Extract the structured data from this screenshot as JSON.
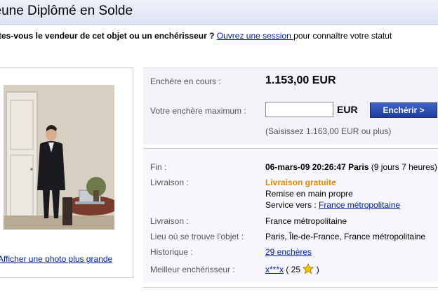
{
  "page": {
    "title": "Jeune Diplômé en Solde"
  },
  "status": {
    "question": "Êtes-vous le vendeur de cet objet ou un enchérisseur ?",
    "login_link": "Ouvrez une session ",
    "suffix": "pour connaître votre statut"
  },
  "photo": {
    "enlarge_link": "Afficher une photo plus grande"
  },
  "bid": {
    "current_label": "Enchère en cours :",
    "current_value": "1.153,00 EUR",
    "max_label": "Votre enchère maximum :",
    "max_value": "",
    "currency": "EUR",
    "button_label": "Enchérir >",
    "hint": "(Saisissez 1.163,00 EUR ou plus)"
  },
  "details": {
    "end_label": "Fin :",
    "end_value": "06-mars-09 20:26:47 Paris",
    "end_remaining": " (9 jours 7 heures)",
    "delivery_label": "Livraison :",
    "delivery_free": "Livraison gratuite",
    "delivery_pickup": "Remise en main propre",
    "service_prefix": "Service vers : ",
    "service_link": "France métropolitaine",
    "delivery2_label": "Livraison :",
    "delivery2_value": "France métropolitaine",
    "location_label": "Lieu où se trouve l'objet :",
    "location_value": "Paris, Île-de-France, France métropolitaine",
    "history_label": "Historique :",
    "history_link": "29 enchères",
    "best_label": "Meilleur enchérisseur :",
    "best_user": "x***x",
    "best_score_open": " ( 25 ",
    "best_score_close": " )"
  },
  "colors": {
    "link": "#00209b",
    "button": "#1f3e9f",
    "free_shipping": "#e28a00",
    "star": "#f4c400"
  },
  "icons": {
    "feedback_star": "star-icon"
  }
}
